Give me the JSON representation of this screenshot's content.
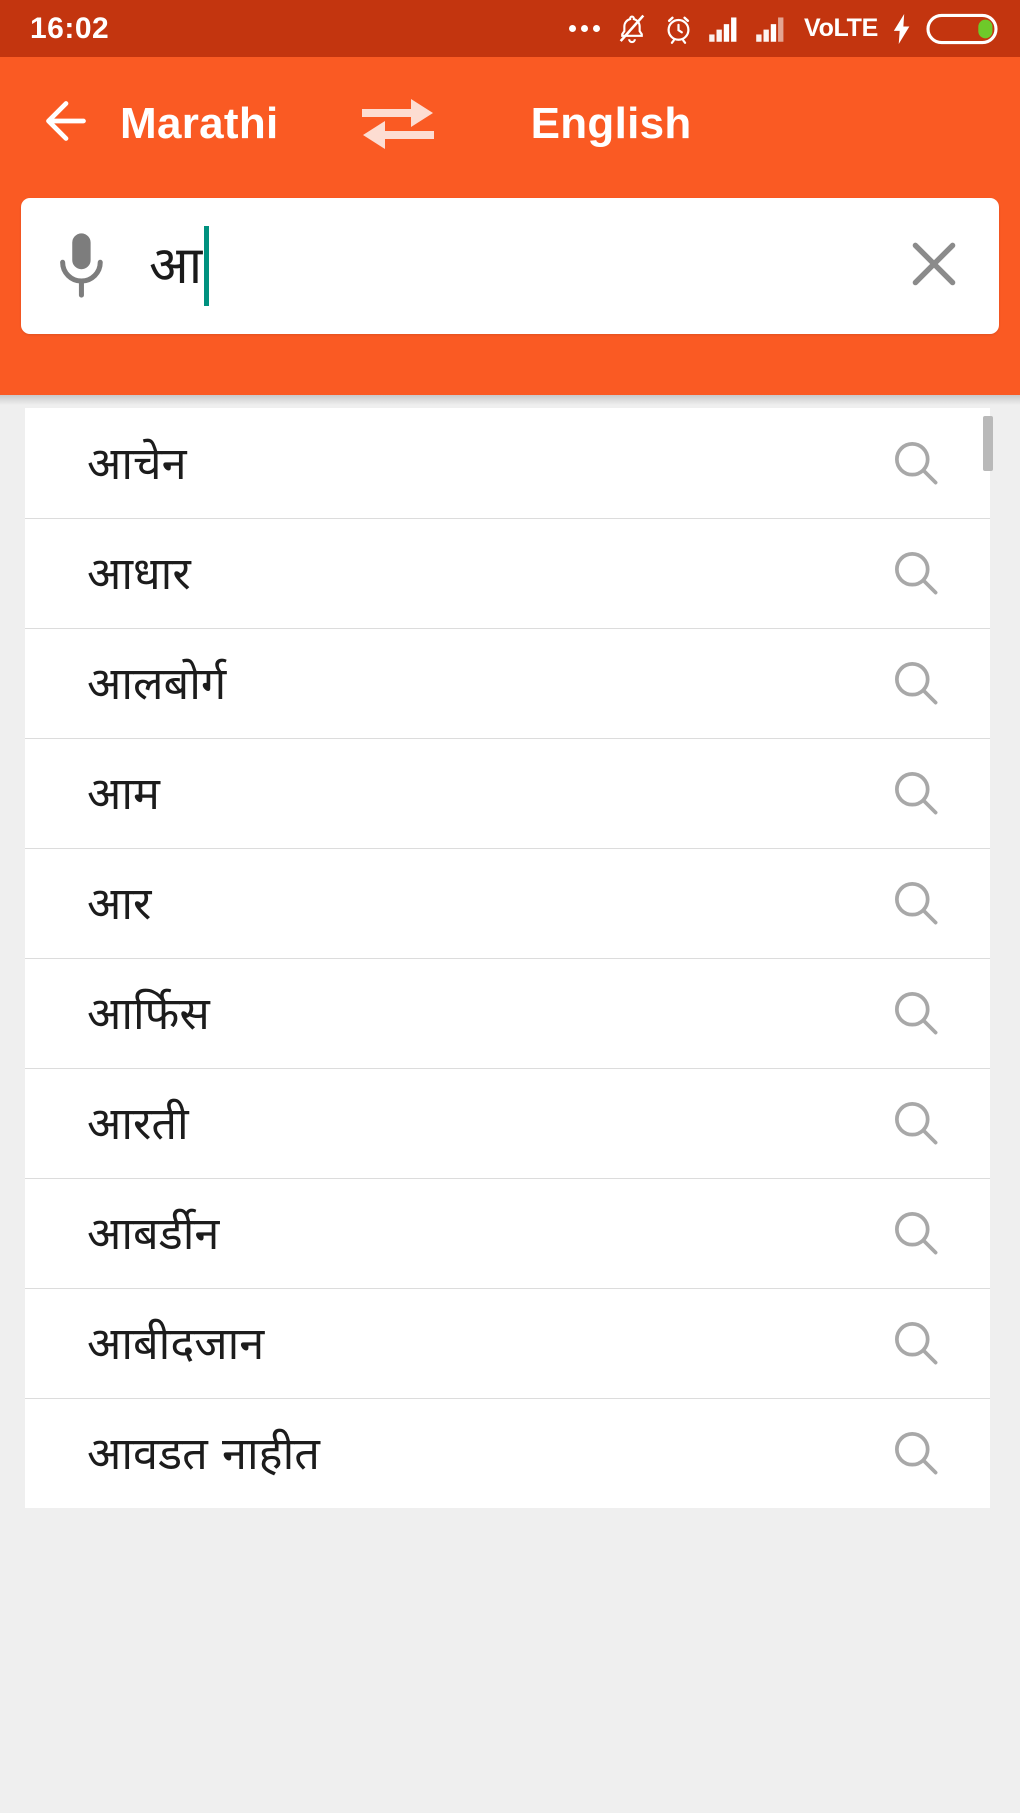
{
  "status_bar": {
    "time": "16:02",
    "volte_label": "VoLTE",
    "icons": [
      "more-dots-icon",
      "bell-muted-icon",
      "alarm-clock-icon",
      "signal-bars-1-icon",
      "signal-bars-2-icon",
      "volte-label",
      "charging-bolt-icon",
      "battery-icon"
    ],
    "battery_fill_color": "#6ec92a",
    "background_color": "#c3350f"
  },
  "app_bar": {
    "back_icon": "arrow-left-icon",
    "source_language": "Marathi",
    "swap_icon": "swap-horizontal-icon",
    "target_language": "English",
    "background_color": "#fa5a23"
  },
  "search": {
    "mic_icon": "microphone-icon",
    "value": "आ",
    "placeholder": "",
    "clear_icon": "close-x-icon",
    "caret_color": "#00917f"
  },
  "suggestions": {
    "row_icon": "search-magnifier-icon",
    "items": [
      {
        "label": "आचेन"
      },
      {
        "label": "आधार"
      },
      {
        "label": "आलबोर्ग"
      },
      {
        "label": "आम"
      },
      {
        "label": "आर"
      },
      {
        "label": "आर्फिस"
      },
      {
        "label": "आरती"
      },
      {
        "label": "आबर्डीन"
      },
      {
        "label": "आबीदजान"
      },
      {
        "label": "आवडत नाहीत"
      }
    ]
  },
  "scrollbar": {
    "position": "top"
  },
  "colors": {
    "accent_orange": "#fa5a23",
    "status_orange_dark": "#c3350f",
    "page_background": "#efefef",
    "card_white": "#ffffff",
    "divider": "#dcdcdc",
    "icon_gray": "#9a9a9a",
    "text_primary": "#1c1c1c"
  }
}
